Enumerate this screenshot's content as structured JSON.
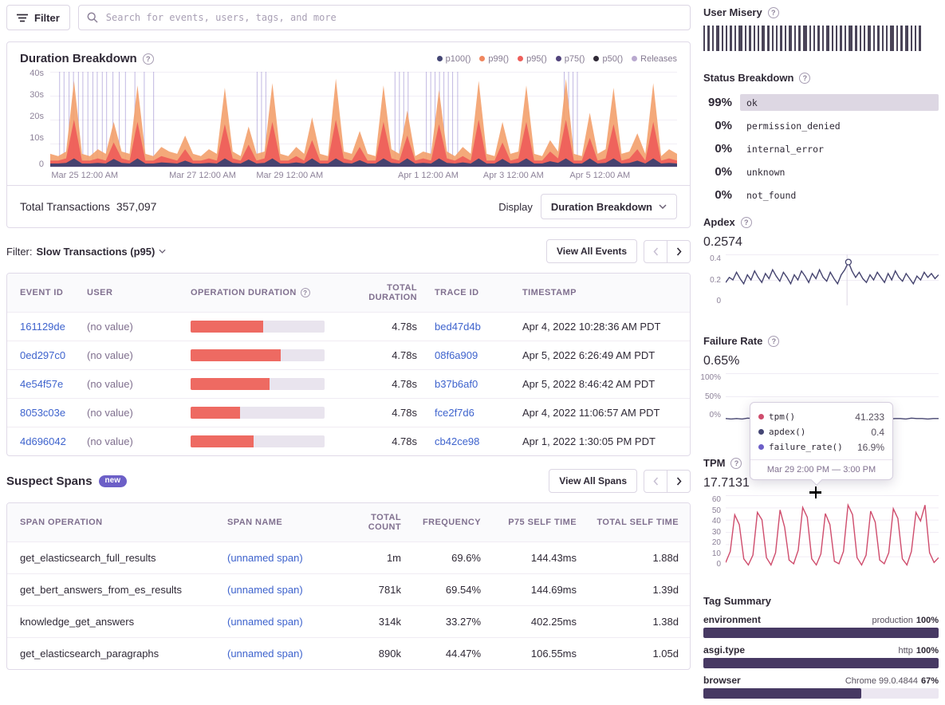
{
  "topbar": {
    "filter_label": "Filter",
    "search_placeholder": "Search for events, users, tags, and more"
  },
  "duration_panel": {
    "title": "Duration Breakdown",
    "legend": [
      {
        "label": "p100()",
        "color": "#444674"
      },
      {
        "label": "p99()",
        "color": "#f0875f"
      },
      {
        "label": "p95()",
        "color": "#ee5f5b"
      },
      {
        "label": "p75()",
        "color": "#52447c"
      },
      {
        "label": "p50()",
        "color": "#2f2936"
      },
      {
        "label": "Releases",
        "color": "#b9a9cf"
      }
    ],
    "y_ticks": [
      "40s",
      "30s",
      "20s",
      "10s",
      "0"
    ],
    "x_ticks": [
      "Mar 25 12:00 AM",
      "Mar 27 12:00 AM",
      "Mar 29 12:00 AM",
      "Apr 1 12:00 AM",
      "Apr 3 12:00 AM",
      "Apr 5 12:00 AM"
    ],
    "footer": {
      "total_label": "Total Transactions",
      "total_value": "357,097",
      "display_label": "Display",
      "display_value": "Duration Breakdown"
    }
  },
  "transactions": {
    "filter_label": "Filter:",
    "filter_value": "Slow Transactions (p95)",
    "view_all": "View All Events",
    "columns": [
      "Event ID",
      "User",
      "Operation Duration",
      "Total Duration",
      "Trace ID",
      "Timestamp"
    ],
    "rows": [
      {
        "event_id": "161129de",
        "user": "(no value)",
        "bar_frac": 0.54,
        "total": "4.78s",
        "trace": "bed47d4b",
        "timestamp": "Apr 4, 2022 10:28:36 AM PDT"
      },
      {
        "event_id": "0ed297c0",
        "user": "(no value)",
        "bar_frac": 0.67,
        "total": "4.78s",
        "trace": "08f6a909",
        "timestamp": "Apr 5, 2022 6:26:49 AM PDT"
      },
      {
        "event_id": "4e54f57e",
        "user": "(no value)",
        "bar_frac": 0.59,
        "total": "4.78s",
        "trace": "b37b6af0",
        "timestamp": "Apr 5, 2022 8:46:42 AM PDT"
      },
      {
        "event_id": "8053c03e",
        "user": "(no value)",
        "bar_frac": 0.37,
        "total": "4.78s",
        "trace": "fce2f7d6",
        "timestamp": "Apr 4, 2022 11:06:57 AM PDT"
      },
      {
        "event_id": "4d696042",
        "user": "(no value)",
        "bar_frac": 0.47,
        "total": "4.78s",
        "trace": "cb42ce98",
        "timestamp": "Apr 1, 2022 1:30:05 PM PDT"
      }
    ]
  },
  "suspect_spans": {
    "title": "Suspect Spans",
    "badge": "new",
    "view_all": "View All Spans",
    "columns": [
      "Span Operation",
      "Span Name",
      "Total Count",
      "Frequency",
      "P75 Self Time",
      "Total Self Time"
    ],
    "rows": [
      {
        "operation": "get_elasticsearch_full_results",
        "name": "(unnamed span)",
        "count": "1m",
        "frequency": "69.6%",
        "p75": "144.43ms",
        "total": "1.88d"
      },
      {
        "operation": "get_bert_answers_from_es_results",
        "name": "(unnamed span)",
        "count": "781k",
        "frequency": "69.54%",
        "p75": "144.69ms",
        "total": "1.39d"
      },
      {
        "operation": "knowledge_get_answers",
        "name": "(unnamed span)",
        "count": "314k",
        "frequency": "33.27%",
        "p75": "402.25ms",
        "total": "1.38d"
      },
      {
        "operation": "get_elasticsearch_paragraphs",
        "name": "(unnamed span)",
        "count": "890k",
        "frequency": "44.47%",
        "p75": "106.55ms",
        "total": "1.05d"
      }
    ]
  },
  "sidebar": {
    "user_misery": {
      "title": "User Misery"
    },
    "status_breakdown": {
      "title": "Status Breakdown",
      "rows": [
        {
          "percent": "99%",
          "label": "ok",
          "has_bar": true
        },
        {
          "percent": "0%",
          "label": "permission_denied",
          "has_bar": false
        },
        {
          "percent": "0%",
          "label": "internal_error",
          "has_bar": false
        },
        {
          "percent": "0%",
          "label": "unknown",
          "has_bar": false
        },
        {
          "percent": "0%",
          "label": "not_found",
          "has_bar": false
        }
      ]
    },
    "apdex": {
      "title": "Apdex",
      "value": "0.2574",
      "y_ticks": [
        "0.4",
        "0.2",
        "0"
      ]
    },
    "failure_rate": {
      "title": "Failure Rate",
      "value": "0.65%",
      "y_ticks": [
        "100%",
        "50%",
        "0%"
      ]
    },
    "tpm": {
      "title": "TPM",
      "value": "17.7131",
      "y_ticks": [
        "60",
        "50",
        "40",
        "30",
        "20",
        "10",
        "0"
      ]
    },
    "tooltip": {
      "rows": [
        {
          "label": "tpm()",
          "value": "41.233",
          "color": "#cf4d6d"
        },
        {
          "label": "apdex()",
          "value": "0.4",
          "color": "#444674"
        },
        {
          "label": "failure_rate()",
          "value": "16.9%",
          "color": "#6c5fc7"
        }
      ],
      "time_range": "Mar 29 2:00 PM — 3:00 PM"
    },
    "tag_summary": {
      "title": "Tag Summary",
      "rows": [
        {
          "key": "environment",
          "value": "production",
          "percent": "100%",
          "frac": 1
        },
        {
          "key": "asgi.type",
          "value": "http",
          "percent": "100%",
          "frac": 1
        },
        {
          "key": "browser",
          "value": "Chrome 99.0.4844",
          "percent": "67%",
          "frac": 0.67
        }
      ]
    }
  },
  "chart_data": [
    {
      "name": "duration_breakdown",
      "type": "area",
      "title": "Duration Breakdown",
      "ylim_seconds": [
        0,
        42
      ],
      "x_tick_fracs": [
        0.055,
        0.243,
        0.382,
        0.603,
        0.739,
        0.877
      ],
      "colors": {
        "p99": "#f3a06b",
        "p95": "#ee5f5b",
        "p50": "#46426f",
        "release": "rgba(118,98,190,0.45)"
      },
      "p99": [
        6,
        5,
        7,
        38,
        6,
        5,
        8,
        6,
        20,
        7,
        6,
        36,
        6,
        5,
        9,
        7,
        6,
        14,
        6,
        5,
        8,
        6,
        35,
        7,
        5,
        18,
        6,
        7,
        37,
        6,
        5,
        9,
        6,
        22,
        6,
        5,
        39,
        7,
        6,
        16,
        6,
        5,
        36,
        8,
        6,
        25,
        5,
        7,
        6,
        34,
        7,
        5,
        9,
        6,
        38,
        6,
        5,
        20,
        6,
        7,
        36,
        6,
        5,
        12,
        7,
        39,
        6,
        5,
        24,
        6,
        8,
        35,
        6,
        7,
        15,
        6,
        37,
        5,
        8,
        6
      ],
      "p95": [
        3,
        3,
        4,
        21,
        3,
        3,
        4,
        3,
        11,
        4,
        3,
        20,
        3,
        3,
        5,
        4,
        3,
        8,
        3,
        3,
        4,
        3,
        19,
        4,
        3,
        10,
        3,
        4,
        20,
        3,
        3,
        5,
        3,
        12,
        3,
        3,
        21,
        4,
        3,
        9,
        3,
        3,
        20,
        4,
        3,
        14,
        3,
        4,
        3,
        19,
        4,
        3,
        5,
        3,
        21,
        3,
        3,
        11,
        3,
        4,
        20,
        3,
        3,
        7,
        4,
        21,
        3,
        3,
        13,
        3,
        4,
        19,
        3,
        4,
        8,
        3,
        20,
        3,
        4,
        3
      ],
      "release_fracs": [
        0.015,
        0.022,
        0.03,
        0.037,
        0.045,
        0.052,
        0.06,
        0.068,
        0.075,
        0.083,
        0.09,
        0.1,
        0.11,
        0.12,
        0.135,
        0.15,
        0.165,
        0.33,
        0.337,
        0.344,
        0.55,
        0.557,
        0.564,
        0.571,
        0.6,
        0.607,
        0.614,
        0.621,
        0.628,
        0.635,
        0.642,
        0.65,
        0.82,
        0.827,
        0.834,
        0.841
      ]
    },
    {
      "name": "apdex_spark",
      "type": "line",
      "ylim": [
        0,
        0.4
      ],
      "color": "#45446f",
      "marker_index": 34,
      "crosshair_frac": 0.57,
      "values": [
        0.18,
        0.22,
        0.2,
        0.26,
        0.21,
        0.17,
        0.24,
        0.2,
        0.27,
        0.22,
        0.18,
        0.25,
        0.21,
        0.28,
        0.23,
        0.19,
        0.26,
        0.22,
        0.17,
        0.24,
        0.2,
        0.27,
        0.23,
        0.18,
        0.25,
        0.21,
        0.28,
        0.22,
        0.19,
        0.26,
        0.21,
        0.17,
        0.24,
        0.28,
        0.34,
        0.27,
        0.22,
        0.26,
        0.21,
        0.18,
        0.24,
        0.2,
        0.26,
        0.22,
        0.18,
        0.25,
        0.2,
        0.27,
        0.22,
        0.19,
        0.25,
        0.21,
        0.17,
        0.23,
        0.2,
        0.26,
        0.22,
        0.25,
        0.21,
        0.24
      ]
    },
    {
      "name": "failure_rate_spark",
      "type": "line",
      "ylim": [
        0,
        100
      ],
      "color": "#45446f",
      "values": [
        2,
        1,
        2,
        1,
        3,
        2,
        1,
        2,
        2,
        2,
        1,
        2,
        2,
        1,
        2,
        3,
        2,
        1,
        2,
        17,
        2,
        1,
        2,
        1,
        2,
        2,
        3,
        1,
        2,
        2,
        1,
        2,
        2,
        1,
        3,
        2,
        2,
        1,
        2,
        2
      ]
    },
    {
      "name": "tpm_spark",
      "type": "line",
      "ylim": [
        0,
        60
      ],
      "color": "#cf4d6d",
      "values": [
        5,
        14,
        44,
        36,
        8,
        3,
        11,
        46,
        40,
        9,
        3,
        13,
        48,
        34,
        7,
        4,
        15,
        50,
        42,
        8,
        3,
        12,
        45,
        36,
        6,
        4,
        14,
        52,
        44,
        9,
        3,
        11,
        47,
        38,
        7,
        4,
        13,
        49,
        41,
        8,
        3,
        14,
        46,
        39,
        52,
        13,
        5,
        9
      ]
    },
    {
      "name": "user_misery_bars",
      "type": "bar",
      "bar_widths": [
        2,
        3,
        2,
        4,
        2,
        2,
        3,
        2,
        5,
        2,
        3,
        2,
        2,
        4,
        3,
        2,
        2,
        3,
        2,
        4,
        2,
        3,
        5,
        2,
        2,
        3,
        2,
        4,
        2,
        2,
        3,
        2,
        5,
        3,
        2,
        2,
        4,
        2,
        3,
        2,
        2,
        5,
        2,
        3,
        4,
        2,
        2,
        3
      ]
    }
  ]
}
